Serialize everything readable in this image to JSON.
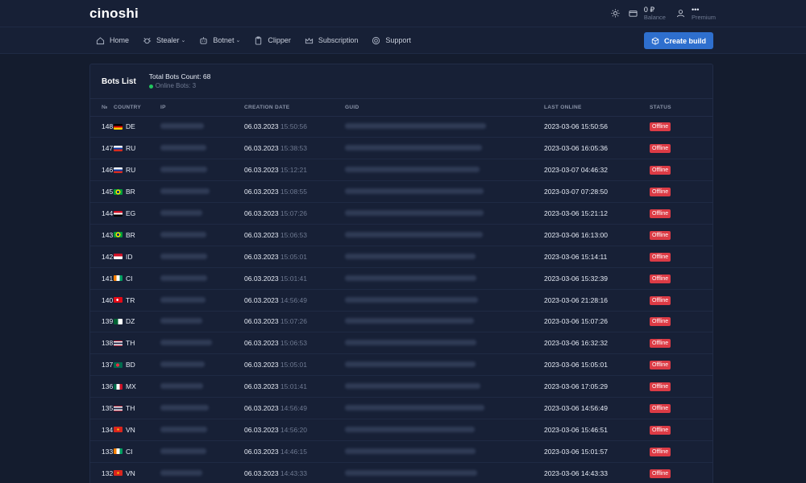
{
  "app": {
    "logo": "cinoshi"
  },
  "topbar": {
    "balance_value": "0 ₽",
    "balance_label": "Balance",
    "user_value": "•••",
    "user_label": "Premium"
  },
  "nav": {
    "home": "Home",
    "stealer": "Stealer",
    "botnet": "Botnet",
    "clipper": "Clipper",
    "subscription": "Subscription",
    "support": "Support",
    "create_build": "Create build"
  },
  "card": {
    "title": "Bots List",
    "total": "Total Bots Count: 68",
    "online": "Online Bots: 3"
  },
  "table": {
    "headers": {
      "no": "№",
      "country": "COUNTRY",
      "ip": "IP",
      "date": "CREATION DATE",
      "guid": "GUID",
      "last": "LAST ONLINE",
      "status": "STATUS"
    },
    "rows": [
      {
        "no": "148",
        "country": "DE",
        "date": "06.03.2023",
        "time": "15:50:56",
        "last": "2023-03-06 15:50:56",
        "status": "Offline"
      },
      {
        "no": "147",
        "country": "RU",
        "date": "06.03.2023",
        "time": "15:38:53",
        "last": "2023-03-06 16:05:36",
        "status": "Offline"
      },
      {
        "no": "146",
        "country": "RU",
        "date": "06.03.2023",
        "time": "15:12:21",
        "last": "2023-03-07 04:46:32",
        "status": "Offline"
      },
      {
        "no": "145",
        "country": "BR",
        "date": "06.03.2023",
        "time": "15:08:55",
        "last": "2023-03-07 07:28:50",
        "status": "Offline"
      },
      {
        "no": "144",
        "country": "EG",
        "date": "06.03.2023",
        "time": "15:07:26",
        "last": "2023-03-06 15:21:12",
        "status": "Offline"
      },
      {
        "no": "143",
        "country": "BR",
        "date": "06.03.2023",
        "time": "15:06:53",
        "last": "2023-03-06 16:13:00",
        "status": "Offline"
      },
      {
        "no": "142",
        "country": "ID",
        "date": "06.03.2023",
        "time": "15:05:01",
        "last": "2023-03-06 15:14:11",
        "status": "Offline"
      },
      {
        "no": "141",
        "country": "CI",
        "date": "06.03.2023",
        "time": "15:01:41",
        "last": "2023-03-06 15:32:39",
        "status": "Offline"
      },
      {
        "no": "140",
        "country": "TR",
        "date": "06.03.2023",
        "time": "14:56:49",
        "last": "2023-03-06 21:28:16",
        "status": "Offline"
      },
      {
        "no": "139",
        "country": "DZ",
        "date": "06.03.2023",
        "time": "15:07:26",
        "last": "2023-03-06 15:07:26",
        "status": "Offline"
      },
      {
        "no": "138",
        "country": "TH",
        "date": "06.03.2023",
        "time": "15:06:53",
        "last": "2023-03-06 16:32:32",
        "status": "Offline"
      },
      {
        "no": "137",
        "country": "BD",
        "date": "06.03.2023",
        "time": "15:05:01",
        "last": "2023-03-06 15:05:01",
        "status": "Offline"
      },
      {
        "no": "136",
        "country": "MX",
        "date": "06.03.2023",
        "time": "15:01:41",
        "last": "2023-03-06 17:05:29",
        "status": "Offline"
      },
      {
        "no": "135",
        "country": "TH",
        "date": "06.03.2023",
        "time": "14:56:49",
        "last": "2023-03-06 14:56:49",
        "status": "Offline"
      },
      {
        "no": "134",
        "country": "VN",
        "date": "06.03.2023",
        "time": "14:56:20",
        "last": "2023-03-06 15:46:51",
        "status": "Offline"
      },
      {
        "no": "133",
        "country": "CI",
        "date": "06.03.2023",
        "time": "14:46:15",
        "last": "2023-03-06 15:01:57",
        "status": "Offline"
      },
      {
        "no": "132",
        "country": "VN",
        "date": "06.03.2023",
        "time": "14:43:33",
        "last": "2023-03-06 14:43:33",
        "status": "Offline"
      }
    ]
  },
  "colors": {
    "background": "#141c2e",
    "panel": "#172036",
    "accent": "#2e6fce",
    "offline": "#dc3b45",
    "online_dot": "#22c55e"
  }
}
